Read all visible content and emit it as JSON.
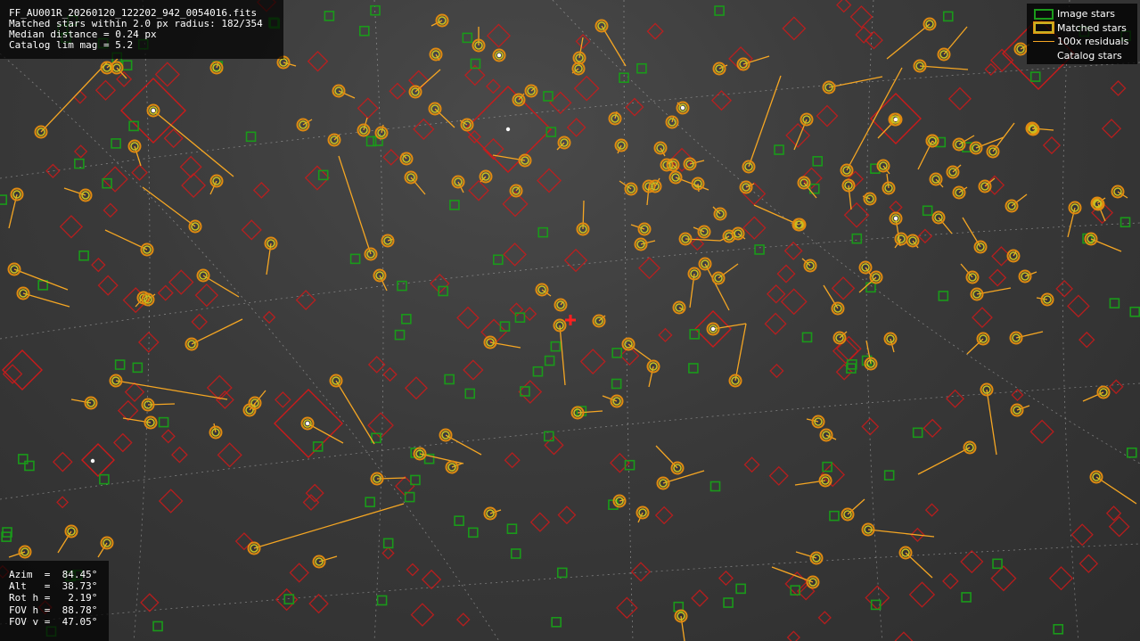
{
  "info": {
    "filename": "FF_AU001R_20260120_122202_942_0054016.fits",
    "matched": "Matched stars within 2.0 px radius: 182/354",
    "median": "Median distance = 0.24 px",
    "catalog": "Catalog lim mag = 5.2"
  },
  "legend": {
    "image_stars": "Image stars",
    "matched_stars": "Matched stars",
    "residuals": "100x residuals",
    "catalog_stars": "Catalog stars"
  },
  "pointing": {
    "azim": "Azim  =  84.45°",
    "alt": "Alt   =  38.73°",
    "rot": "Rot h =   2.19°",
    "fovh": "FOV h =  88.78°",
    "fovv": "FOV v =  47.05°"
  },
  "colors": {
    "image_star": "#1a9a1a",
    "matched_outer": "#e08a10",
    "matched_inner": "#c8c020",
    "residual": "#f5a623",
    "catalog": "#cc1a1a",
    "grid": "#bdbdbd",
    "center_marker": "#ff2020"
  },
  "icons": {
    "center": "red-cross-marker"
  }
}
